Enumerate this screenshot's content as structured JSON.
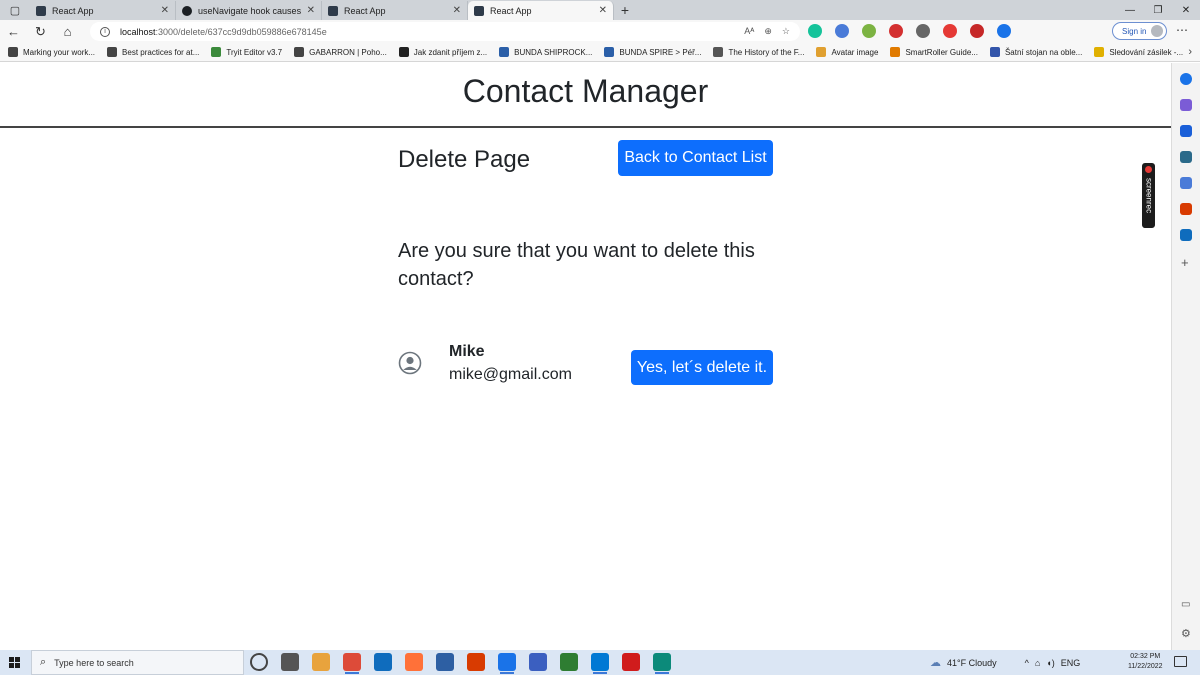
{
  "browser": {
    "tabs": [
      {
        "title": "React App",
        "icon": "react-icon"
      },
      {
        "title": "useNavigate hook causes waste",
        "icon": "github-icon"
      },
      {
        "title": "React App",
        "icon": "react-icon"
      },
      {
        "title": "React App",
        "icon": "react-icon",
        "active": true
      }
    ],
    "address": {
      "host": "localhost",
      "path": ":3000/delete/637cc9d9db059886e678145e"
    },
    "signin_label": "Sign in",
    "bookmarks": [
      "Marking your work...",
      "Best practices for at...",
      "Tryit Editor v3.7",
      "GABARRON | Poho...",
      "Jak zdanit příjem z...",
      "BUNDA SHIPROCK...",
      "BUNDA SPIRE > Péř...",
      "The History of the F...",
      "Avatar image",
      "SmartRoller Guide...",
      "Šatní stojan na oble...",
      "Sledování zásilek -..."
    ],
    "bookmark_colors": [
      "#444",
      "#444",
      "#3b8a3b",
      "#444",
      "#222",
      "#2b5fa8",
      "#2b5fa8",
      "#555",
      "#e0a030",
      "#e07a00",
      "#3355aa",
      "#e0b000"
    ],
    "extension_colors": [
      "#15c39a",
      "#4a7bd8",
      "#7cb342",
      "#d32f2f",
      "#666",
      "#e53935",
      "#c62828",
      "#1a73e8"
    ]
  },
  "app": {
    "title": "Contact Manager",
    "page_heading": "Delete Page",
    "back_button": "Back to Contact List",
    "question": "Are you sure that you want to delete this contact?",
    "contact": {
      "name": "Mike",
      "email": "mike@gmail.com"
    },
    "delete_button": "Yes, let´s delete it.",
    "accent": "#0d6efd"
  },
  "overlay": {
    "screenrec_label": "screenrec"
  },
  "taskbar": {
    "search_placeholder": "Type here to search",
    "weather": "41°F  Cloudy",
    "language": "ENG",
    "time": "02:32 PM",
    "date": "11/22/2022",
    "app_colors": [
      "#444",
      "#555",
      "#e8a33d",
      "#dd4b39",
      "#0f6cbd",
      "#ff7139",
      "#2d5fa3",
      "#d83b01",
      "#1a73e8",
      "#3b5fc0",
      "#2e7d32",
      "#0078d4",
      "#d01c1c",
      "#0c8a7a"
    ]
  }
}
